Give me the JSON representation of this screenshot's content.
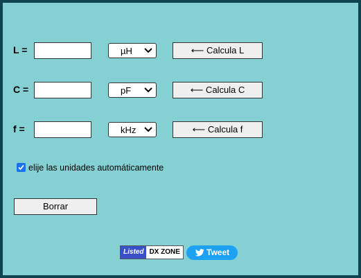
{
  "rows": [
    {
      "label": "L =",
      "value": "",
      "unit": "µH",
      "button": "⟵ Calcula L"
    },
    {
      "label": "C =",
      "value": "",
      "unit": "pF",
      "button": "⟵ Calcula C"
    },
    {
      "label": "f =",
      "value": "",
      "unit": "kHz",
      "button": "⟵ Calcula f"
    }
  ],
  "auto_units": {
    "checked": true,
    "label": "elije las unidades automáticamente"
  },
  "clear_button": "Borrar",
  "badge": {
    "left": "Listed",
    "right": "DX ZONE"
  },
  "tweet": {
    "label": "Tweet",
    "icon": "twitter-bird-icon"
  },
  "colors": {
    "background": "#85d0d3",
    "border": "#0d4450",
    "button": "#efefef",
    "checkbox": "#1a73e8",
    "tweet": "#1da1f2",
    "badge_left": "#3a4fc8"
  }
}
